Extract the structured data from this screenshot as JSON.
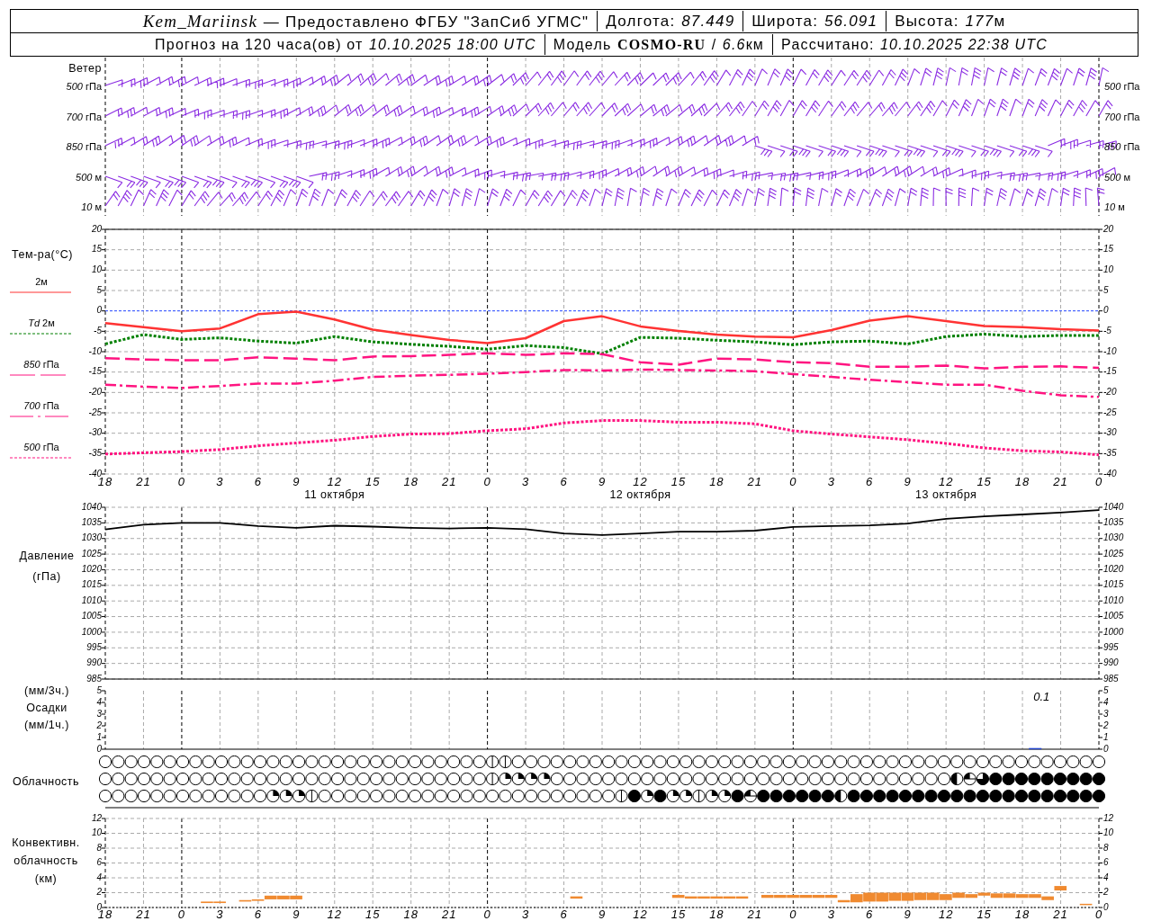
{
  "header": {
    "row_1": [
      [
        {
          "text": "Kem_Mariinsk",
          "kind": "station"
        },
        {
          "text": "— Предоставлено ФГБУ \"ЗапСиб УГМС\"",
          "kind": "plain"
        }
      ],
      [
        {
          "text": "Долгота:",
          "kind": "plain"
        },
        {
          "text": "87.449",
          "kind": "italic"
        }
      ],
      [
        {
          "text": "Широта:",
          "kind": "plain"
        },
        {
          "text": "56.091",
          "kind": "italic"
        }
      ],
      [
        {
          "text": "Высота:",
          "kind": "plain"
        },
        {
          "text": "177",
          "kind": "italic"
        },
        {
          "text": "м",
          "kind": "unit"
        }
      ]
    ],
    "row_2": [
      [
        {
          "text": "Прогноз на 120 часа(ов) от",
          "kind": "plain"
        },
        {
          "text": "10.10.2025 18:00 UTC",
          "kind": "italic"
        }
      ],
      [
        {
          "text": "Модель",
          "kind": "plain"
        },
        {
          "text": "COSMO-RU",
          "kind": "bold"
        },
        {
          "text": "/",
          "kind": "plain"
        },
        {
          "text": "6.6",
          "kind": "italic"
        },
        {
          "text": "км",
          "kind": "unit"
        }
      ],
      [
        {
          "text": "Рассчитано:",
          "kind": "plain"
        },
        {
          "text": "10.10.2025 22:38 UTC",
          "kind": "italic"
        }
      ]
    ]
  },
  "wind": {
    "title": "Ветер",
    "levels": [
      {
        "left": "*500* гПа",
        "right": "*500* гПа"
      },
      {
        "left": "*700* гПа",
        "right": "*700* гПа"
      },
      {
        "left": "*850* гПа",
        "right": "*850* гПа"
      },
      {
        "left": "*500* м",
        "right": "*500* м"
      },
      {
        "left": "*10* м",
        "right": "*10* м"
      }
    ]
  },
  "temperature": {
    "title": "Тем-ра(°C)",
    "dates": [
      "11 октября",
      "12 октября",
      "13 октября"
    ],
    "right_ticks": [
      "20",
      "15",
      "10",
      "5",
      "0",
      "-5",
      "-10",
      "-15",
      "-20",
      "-25",
      "-30",
      "-35",
      "-40"
    ],
    "chart_data": {
      "type": "line",
      "grid": true,
      "categories": [
        "18",
        "21",
        "0",
        "3",
        "6",
        "9",
        "12",
        "15",
        "18",
        "21",
        "0",
        "3",
        "6",
        "9",
        "12",
        "15",
        "18",
        "21",
        "0",
        "3",
        "6",
        "9",
        "12",
        "15",
        "18",
        "21",
        "0"
      ],
      "ylim": [
        -40,
        20
      ],
      "yticks": [
        -40,
        -35,
        -30,
        -25,
        -20,
        -15,
        -10,
        -5,
        0,
        5,
        10,
        15,
        20
      ],
      "ref_lines": [
        {
          "axis": "y",
          "value": 0,
          "color": "#2244ff",
          "line_style": "dotted"
        }
      ],
      "series": [
        {
          "name": "2м",
          "color": "#ff3333",
          "line_style": "solid",
          "values": [
            -3.0,
            -4.0,
            -5.0,
            -4.3,
            -0.8,
            -0.2,
            -2.1,
            -4.6,
            -5.9,
            -7.1,
            -7.9,
            -6.7,
            -2.5,
            -1.3,
            -3.8,
            -4.9,
            -5.8,
            -6.3,
            -6.5,
            -4.7,
            -2.4,
            -1.3,
            -2.5,
            -3.7,
            -4.0,
            -4.5,
            -4.8
          ]
        },
        {
          "name": "*Td* 2м",
          "color": "#008000",
          "line_style": "dotted",
          "values": [
            -8.1,
            -5.8,
            -7.0,
            -6.6,
            -7.4,
            -7.9,
            -6.3,
            -7.6,
            -8.2,
            -8.7,
            -9.4,
            -8.5,
            -9.0,
            -10.5,
            -6.5,
            -6.7,
            -7.2,
            -7.6,
            -8.3,
            -7.6,
            -7.4,
            -8.1,
            -6.3,
            -5.7,
            -6.3,
            -6.0,
            -6.0
          ]
        },
        {
          "name": "*850* гПа",
          "color": "#ff1480",
          "line_style": "dashed",
          "values": [
            -11.6,
            -11.9,
            -12.1,
            -12.1,
            -11.4,
            -11.7,
            -12.1,
            -11.2,
            -11.1,
            -10.8,
            -10.4,
            -10.8,
            -10.4,
            -10.6,
            -12.6,
            -13.2,
            -11.7,
            -11.9,
            -12.6,
            -12.8,
            -13.7,
            -13.7,
            -13.4,
            -14.1,
            -13.7,
            -13.6,
            -14.0
          ]
        },
        {
          "name": "*700* гПа",
          "color": "#ff1480",
          "line_style": "dashdot",
          "values": [
            -18.1,
            -18.6,
            -18.9,
            -18.4,
            -17.8,
            -17.8,
            -17.1,
            -16.2,
            -15.9,
            -15.7,
            -15.4,
            -15.0,
            -14.5,
            -14.6,
            -14.4,
            -14.5,
            -14.6,
            -14.8,
            -15.5,
            -16.2,
            -16.9,
            -17.5,
            -18.1,
            -18.1,
            -19.6,
            -20.7,
            -21.1
          ]
        },
        {
          "name": "*500* гПа",
          "color": "#ff1480",
          "line_style": "dotted",
          "values": [
            -35.1,
            -34.8,
            -34.5,
            -34.0,
            -33.1,
            -32.4,
            -31.7,
            -30.8,
            -30.2,
            -30.1,
            -29.4,
            -28.9,
            -27.5,
            -26.9,
            -26.9,
            -27.3,
            -27.3,
            -27.7,
            -29.4,
            -30.2,
            -30.9,
            -31.6,
            -32.5,
            -33.6,
            -34.3,
            -34.6,
            -35.3
          ]
        }
      ]
    }
  },
  "pressure": {
    "label_lines": [
      "Давление",
      "(гПа)"
    ],
    "right_ticks": [
      "1040",
      "1035",
      "1030",
      "1025",
      "1020",
      "1015",
      "1010",
      "1005",
      "1000",
      "995",
      "990",
      "985"
    ],
    "chart_data": {
      "type": "line",
      "grid": true,
      "categories": [
        null,
        null,
        null,
        null,
        null,
        null,
        null,
        null,
        null,
        null,
        null,
        null,
        null,
        null,
        null,
        null,
        null,
        null,
        null,
        null,
        null,
        null,
        null,
        null,
        null,
        null,
        null
      ],
      "ylim": [
        985,
        1040
      ],
      "yticks": [
        985,
        990,
        995,
        1000,
        1005,
        1010,
        1015,
        1020,
        1025,
        1030,
        1035,
        1040
      ],
      "values": [
        1032.9,
        1034.4,
        1035.0,
        1035.0,
        1034.0,
        1033.4,
        1034.1,
        1033.8,
        1033.4,
        1033.2,
        1033.4,
        1033.0,
        1031.6,
        1031.1,
        1031.6,
        1032.2,
        1032.2,
        1032.5,
        1033.7,
        1034.0,
        1034.2,
        1034.8,
        1036.3,
        1037.1,
        1037.7,
        1038.3,
        1039.1
      ]
    }
  },
  "precipitation": {
    "label_lines": [
      "(мм/3ч.)",
      "Осадки",
      "(мм/1ч.)"
    ],
    "right_ticks": [
      "5",
      "4",
      "3",
      "2",
      "1",
      "0"
    ],
    "chart_data": {
      "type": "bar",
      "grid": true,
      "categories": [
        null,
        null,
        null,
        null,
        null,
        null,
        null,
        null,
        null,
        null,
        null,
        null,
        null,
        null,
        null,
        null,
        null,
        null,
        null,
        null,
        null,
        null,
        null,
        null,
        null,
        null,
        null,
        null,
        null,
        null,
        null,
        null,
        null,
        null,
        null,
        null,
        null,
        null,
        null,
        null,
        null,
        null,
        null,
        null,
        null,
        null,
        null,
        null,
        null,
        null,
        null,
        null,
        null,
        null,
        null,
        null,
        null,
        null,
        null,
        null,
        null,
        null,
        null,
        null,
        null,
        null,
        null,
        null,
        null,
        null,
        null,
        null,
        null,
        null,
        null,
        null,
        null,
        null,
        null
      ],
      "values": [
        0,
        0,
        0,
        0,
        0,
        0,
        0,
        0,
        0,
        0,
        0,
        0,
        0,
        0,
        0,
        0,
        0,
        0,
        0,
        0,
        0,
        0,
        0,
        0,
        0,
        0,
        0,
        0,
        0,
        0,
        0,
        0,
        0,
        0,
        0,
        0,
        0,
        0,
        0,
        0,
        0,
        0,
        0,
        0,
        0,
        0,
        0,
        0,
        0,
        0,
        0,
        0,
        0,
        0,
        0,
        0,
        0,
        0,
        0,
        0,
        0,
        0,
        0,
        0,
        0,
        0,
        0,
        0,
        0,
        0,
        0,
        0,
        0,
        0.1,
        0,
        0,
        0,
        0,
        0
      ],
      "ylim": [
        0,
        5
      ],
      "yticks": [
        0,
        1,
        2,
        3,
        4,
        5
      ],
      "annotations": [
        "0.1"
      ]
    }
  },
  "clouds": {
    "label": "Облачность",
    "rows": [
      {
        "cells": [
          {
            "kind": "clear"
          },
          {
            "kind": "clear"
          },
          {
            "kind": "clear"
          },
          {
            "kind": "clear"
          },
          {
            "kind": "clear"
          },
          {
            "kind": "clear"
          },
          {
            "kind": "clear"
          },
          {
            "kind": "clear"
          },
          {
            "kind": "clear"
          },
          {
            "kind": "clear"
          },
          {
            "kind": "clear"
          },
          {
            "kind": "clear"
          },
          {
            "kind": "clear"
          },
          {
            "kind": "clear"
          },
          {
            "kind": "clear"
          },
          {
            "kind": "clear"
          },
          {
            "kind": "clear"
          },
          {
            "kind": "clear"
          },
          {
            "kind": "clear"
          },
          {
            "kind": "clear"
          },
          {
            "kind": "clear"
          },
          {
            "kind": "clear"
          },
          {
            "kind": "clear"
          },
          {
            "kind": "clear"
          },
          {
            "kind": "clear"
          },
          {
            "kind": "clear"
          },
          {
            "kind": "clear"
          },
          {
            "kind": "clear"
          },
          {
            "kind": "clear"
          },
          {
            "kind": "clear"
          },
          {
            "kind": "trace"
          },
          {
            "kind": "trace"
          },
          {
            "kind": "clear"
          },
          {
            "kind": "clear"
          },
          {
            "kind": "clear"
          },
          {
            "kind": "clear"
          },
          {
            "kind": "clear"
          },
          {
            "kind": "clear"
          },
          {
            "kind": "clear"
          },
          {
            "kind": "clear"
          },
          {
            "kind": "clear"
          },
          {
            "kind": "clear"
          },
          {
            "kind": "clear"
          },
          {
            "kind": "clear"
          },
          {
            "kind": "clear"
          },
          {
            "kind": "clear"
          },
          {
            "kind": "clear"
          },
          {
            "kind": "clear"
          },
          {
            "kind": "clear"
          },
          {
            "kind": "clear"
          },
          {
            "kind": "clear"
          },
          {
            "kind": "clear"
          },
          {
            "kind": "clear"
          },
          {
            "kind": "clear"
          },
          {
            "kind": "clear"
          },
          {
            "kind": "clear"
          },
          {
            "kind": "clear"
          },
          {
            "kind": "clear"
          },
          {
            "kind": "clear"
          },
          {
            "kind": "clear"
          },
          {
            "kind": "clear"
          },
          {
            "kind": "clear"
          },
          {
            "kind": "clear"
          },
          {
            "kind": "clear"
          },
          {
            "kind": "clear"
          },
          {
            "kind": "clear"
          },
          {
            "kind": "clear"
          },
          {
            "kind": "clear"
          },
          {
            "kind": "clear"
          },
          {
            "kind": "clear"
          },
          {
            "kind": "clear"
          },
          {
            "kind": "clear"
          },
          {
            "kind": "clear"
          },
          {
            "kind": "clear"
          },
          {
            "kind": "clear"
          },
          {
            "kind": "clear"
          },
          {
            "kind": "clear"
          },
          {
            "kind": "clear"
          }
        ]
      },
      {
        "cells": [
          {
            "kind": "clear"
          },
          {
            "kind": "clear"
          },
          {
            "kind": "clear"
          },
          {
            "kind": "clear"
          },
          {
            "kind": "clear"
          },
          {
            "kind": "clear"
          },
          {
            "kind": "clear"
          },
          {
            "kind": "clear"
          },
          {
            "kind": "clear"
          },
          {
            "kind": "clear"
          },
          {
            "kind": "clear"
          },
          {
            "kind": "clear"
          },
          {
            "kind": "clear"
          },
          {
            "kind": "clear"
          },
          {
            "kind": "clear"
          },
          {
            "kind": "clear"
          },
          {
            "kind": "clear"
          },
          {
            "kind": "clear"
          },
          {
            "kind": "clear"
          },
          {
            "kind": "clear"
          },
          {
            "kind": "clear"
          },
          {
            "kind": "clear"
          },
          {
            "kind": "clear"
          },
          {
            "kind": "clear"
          },
          {
            "kind": "clear"
          },
          {
            "kind": "clear"
          },
          {
            "kind": "clear"
          },
          {
            "kind": "clear"
          },
          {
            "kind": "clear"
          },
          {
            "kind": "clear"
          },
          {
            "kind": "trace"
          },
          {
            "kind": "quarter"
          },
          {
            "kind": "quarter"
          },
          {
            "kind": "quarter"
          },
          {
            "kind": "quarter"
          },
          {
            "kind": "clear"
          },
          {
            "kind": "clear"
          },
          {
            "kind": "clear"
          },
          {
            "kind": "clear"
          },
          {
            "kind": "clear"
          },
          {
            "kind": "clear"
          },
          {
            "kind": "clear"
          },
          {
            "kind": "clear"
          },
          {
            "kind": "clear"
          },
          {
            "kind": "clear"
          },
          {
            "kind": "clear"
          },
          {
            "kind": "clear"
          },
          {
            "kind": "clear"
          },
          {
            "kind": "clear"
          },
          {
            "kind": "clear"
          },
          {
            "kind": "clear"
          },
          {
            "kind": "clear"
          },
          {
            "kind": "clear"
          },
          {
            "kind": "clear"
          },
          {
            "kind": "clear"
          },
          {
            "kind": "clear"
          },
          {
            "kind": "clear"
          },
          {
            "kind": "clear"
          },
          {
            "kind": "clear"
          },
          {
            "kind": "clear"
          },
          {
            "kind": "clear"
          },
          {
            "kind": "clear"
          },
          {
            "kind": "clear"
          },
          {
            "kind": "clear"
          },
          {
            "kind": "clear"
          },
          {
            "kind": "clear"
          },
          {
            "kind": "half"
          },
          {
            "kind": "bar"
          },
          {
            "kind": "three"
          },
          {
            "kind": "full"
          },
          {
            "kind": "full"
          },
          {
            "kind": "full"
          },
          {
            "kind": "full"
          },
          {
            "kind": "full"
          },
          {
            "kind": "full"
          },
          {
            "kind": "full"
          },
          {
            "kind": "full"
          },
          {
            "kind": "full"
          }
        ]
      },
      {
        "cells": [
          {
            "kind": "clear"
          },
          {
            "kind": "clear"
          },
          {
            "kind": "clear"
          },
          {
            "kind": "clear"
          },
          {
            "kind": "clear"
          },
          {
            "kind": "clear"
          },
          {
            "kind": "clear"
          },
          {
            "kind": "clear"
          },
          {
            "kind": "clear"
          },
          {
            "kind": "clear"
          },
          {
            "kind": "clear"
          },
          {
            "kind": "clear"
          },
          {
            "kind": "clear"
          },
          {
            "kind": "quarter"
          },
          {
            "kind": "quarter"
          },
          {
            "kind": "quarter"
          },
          {
            "kind": "trace"
          },
          {
            "kind": "clear"
          },
          {
            "kind": "clear"
          },
          {
            "kind": "clear"
          },
          {
            "kind": "clear"
          },
          {
            "kind": "clear"
          },
          {
            "kind": "clear"
          },
          {
            "kind": "clear"
          },
          {
            "kind": "clear"
          },
          {
            "kind": "clear"
          },
          {
            "kind": "clear"
          },
          {
            "kind": "clear"
          },
          {
            "kind": "clear"
          },
          {
            "kind": "clear"
          },
          {
            "kind": "clear"
          },
          {
            "kind": "clear"
          },
          {
            "kind": "clear"
          },
          {
            "kind": "clear"
          },
          {
            "kind": "clear"
          },
          {
            "kind": "clear"
          },
          {
            "kind": "clear"
          },
          {
            "kind": "clear"
          },
          {
            "kind": "clear"
          },
          {
            "kind": "clear"
          },
          {
            "kind": "trace"
          },
          {
            "kind": "full"
          },
          {
            "kind": "quarter"
          },
          {
            "kind": "full"
          },
          {
            "kind": "quarter"
          },
          {
            "kind": "quarter"
          },
          {
            "kind": "trace"
          },
          {
            "kind": "quarter"
          },
          {
            "kind": "quarter"
          },
          {
            "kind": "full"
          },
          {
            "kind": "bar"
          },
          {
            "kind": "full"
          },
          {
            "kind": "full"
          },
          {
            "kind": "full"
          },
          {
            "kind": "full"
          },
          {
            "kind": "full"
          },
          {
            "kind": "full"
          },
          {
            "kind": "half"
          },
          {
            "kind": "full"
          },
          {
            "kind": "full"
          },
          {
            "kind": "full"
          },
          {
            "kind": "full"
          },
          {
            "kind": "full"
          },
          {
            "kind": "full"
          },
          {
            "kind": "full"
          },
          {
            "kind": "full"
          },
          {
            "kind": "full"
          },
          {
            "kind": "full"
          },
          {
            "kind": "full"
          },
          {
            "kind": "full"
          },
          {
            "kind": "full"
          },
          {
            "kind": "full"
          },
          {
            "kind": "full"
          },
          {
            "kind": "full"
          },
          {
            "kind": "full"
          },
          {
            "kind": "full"
          },
          {
            "kind": "full"
          },
          {
            "kind": "full"
          }
        ]
      }
    ]
  },
  "convective": {
    "label_lines": [
      "Конвективн.",
      "облачность",
      "(км)"
    ],
    "right_ticks": [
      "12",
      "10",
      "8",
      "6",
      "4",
      "2",
      "0"
    ],
    "chart_data": {
      "type": "candlestick",
      "grid": true,
      "categories": [
        "18",
        null,
        null,
        "21",
        null,
        null,
        "0",
        null,
        null,
        "3",
        null,
        null,
        "6",
        null,
        null,
        "9",
        null,
        null,
        "12",
        null,
        null,
        "15",
        null,
        null,
        "18",
        null,
        null,
        "21",
        null,
        null,
        "0",
        null,
        null,
        "3",
        null,
        null,
        "6",
        null,
        null,
        "9",
        null,
        null,
        "12",
        null,
        null,
        "15",
        null,
        null,
        "18",
        null,
        null,
        "21",
        null,
        null,
        "0",
        null,
        null,
        "3",
        null,
        null,
        "6",
        null,
        null,
        "9",
        null,
        null,
        "12",
        null,
        null,
        "15",
        null,
        null,
        "18",
        null,
        null,
        "21",
        null,
        null,
        "0"
      ],
      "ylim": [
        0,
        12
      ],
      "yticks": [
        0,
        2,
        4,
        6,
        8,
        10,
        12
      ],
      "color": "#f08a30",
      "ohlc": [
        null,
        null,
        null,
        null,
        null,
        null,
        null,
        null,
        [
          0.6,
          0.8,
          0.6,
          0.8
        ],
        [
          0.6,
          0.8,
          0.6,
          0.8
        ],
        null,
        [
          0.8,
          1.0,
          0.8,
          1.0
        ],
        [
          0.9,
          1.1,
          0.9,
          1.1
        ],
        [
          1.1,
          1.6,
          1.1,
          1.6
        ],
        [
          1.1,
          1.6,
          1.1,
          1.6
        ],
        [
          1.1,
          1.6,
          1.1,
          1.6
        ],
        null,
        null,
        null,
        null,
        null,
        null,
        null,
        null,
        null,
        null,
        null,
        null,
        null,
        null,
        null,
        null,
        null,
        null,
        null,
        null,
        null,
        [
          1.2,
          1.5,
          1.2,
          1.5
        ],
        null,
        null,
        null,
        null,
        null,
        null,
        null,
        [
          1.3,
          1.7,
          1.3,
          1.7
        ],
        [
          1.2,
          1.5,
          1.2,
          1.5
        ],
        [
          1.2,
          1.5,
          1.2,
          1.5
        ],
        [
          1.2,
          1.5,
          1.2,
          1.5
        ],
        [
          1.2,
          1.5,
          1.2,
          1.5
        ],
        [
          1.2,
          1.5,
          1.2,
          1.5
        ],
        null,
        [
          1.3,
          1.7,
          1.3,
          1.7
        ],
        [
          1.3,
          1.7,
          1.3,
          1.7
        ],
        [
          1.3,
          1.7,
          1.3,
          1.7
        ],
        [
          1.3,
          1.7,
          1.3,
          1.7
        ],
        [
          1.3,
          1.7,
          1.3,
          1.7
        ],
        [
          1.3,
          1.7,
          1.3,
          1.7
        ],
        [
          0.7,
          1.0,
          0.7,
          1.0
        ],
        [
          0.7,
          1.8,
          0.7,
          1.8
        ],
        [
          0.8,
          2.0,
          0.8,
          2.0
        ],
        [
          0.8,
          2.0,
          0.8,
          2.0
        ],
        [
          0.9,
          2.0,
          0.9,
          2.0
        ],
        [
          0.9,
          2.0,
          0.9,
          2.0
        ],
        [
          1.0,
          2.0,
          1.0,
          2.0
        ],
        [
          1.0,
          2.0,
          1.0,
          2.0
        ],
        [
          1.0,
          1.8,
          1.0,
          1.8
        ],
        [
          1.3,
          2.0,
          1.3,
          2.0
        ],
        [
          1.3,
          1.8,
          1.3,
          1.8
        ],
        [
          1.6,
          2.0,
          1.6,
          2.0
        ],
        [
          1.3,
          1.9,
          1.3,
          1.9
        ],
        [
          1.3,
          1.9,
          1.3,
          1.9
        ],
        [
          1.3,
          1.8,
          1.3,
          1.8
        ],
        [
          1.3,
          1.8,
          1.3,
          1.8
        ],
        [
          1.0,
          1.5,
          1.0,
          1.5
        ],
        [
          2.3,
          2.9,
          2.3,
          2.9
        ],
        null,
        [
          0.4,
          0.5,
          0.4,
          0.5
        ],
        null
      ]
    }
  }
}
